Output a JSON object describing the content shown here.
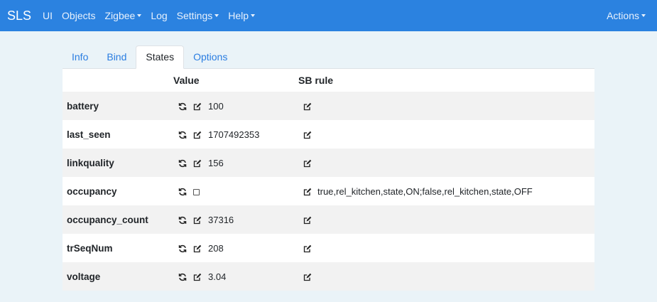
{
  "navbar": {
    "brand": "SLS",
    "items": [
      {
        "label": "UI",
        "dropdown": false
      },
      {
        "label": "Objects",
        "dropdown": false
      },
      {
        "label": "Zigbee",
        "dropdown": true
      },
      {
        "label": "Log",
        "dropdown": false
      },
      {
        "label": "Settings",
        "dropdown": true
      },
      {
        "label": "Help",
        "dropdown": true
      }
    ],
    "actions": "Actions",
    "color": "#2b82e0"
  },
  "tabs": [
    {
      "label": "Info",
      "active": false
    },
    {
      "label": "Bind",
      "active": false
    },
    {
      "label": "States",
      "active": true
    },
    {
      "label": "Options",
      "active": false
    }
  ],
  "table": {
    "headers": {
      "name": "",
      "value": "Value",
      "sb_rule": "SB rule"
    },
    "rows": [
      {
        "name": "battery",
        "value": "100",
        "type": "text",
        "rule": ""
      },
      {
        "name": "last_seen",
        "value": "1707492353",
        "type": "text",
        "rule": ""
      },
      {
        "name": "linkquality",
        "value": "156",
        "type": "text",
        "rule": ""
      },
      {
        "name": "occupancy",
        "value": "",
        "type": "checkbox",
        "checked": false,
        "rule": "true,rel_kitchen,state,ON;false,rel_kitchen,state,OFF"
      },
      {
        "name": "occupancy_count",
        "value": "37316",
        "type": "text",
        "rule": ""
      },
      {
        "name": "trSeqNum",
        "value": "208",
        "type": "text",
        "rule": ""
      },
      {
        "name": "voltage",
        "value": "3.04",
        "type": "text",
        "rule": ""
      }
    ]
  }
}
